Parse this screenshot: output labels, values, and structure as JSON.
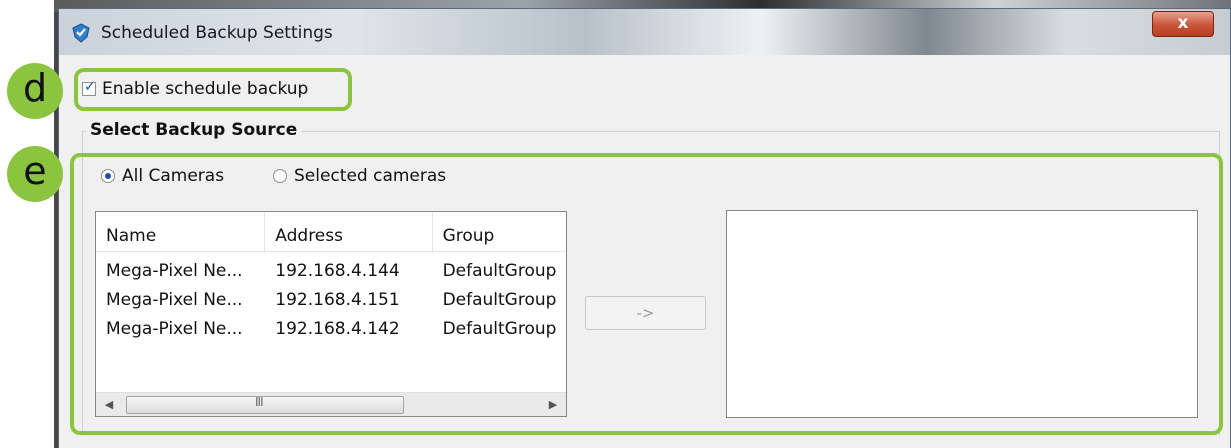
{
  "window": {
    "title": "Scheduled Backup Settings",
    "close_label": "x"
  },
  "enable_backup": {
    "label": "Enable schedule backup",
    "checked": true
  },
  "source_group": {
    "title": "Select Backup Source"
  },
  "source_options": [
    {
      "label": "All Cameras",
      "selected": true
    },
    {
      "label": "Selected cameras",
      "selected": false
    }
  ],
  "camera_list": {
    "columns": [
      "Name",
      "Address",
      "Group"
    ],
    "rows": [
      [
        "Mega-Pixel Ne...",
        "192.168.4.144",
        "DefaultGroup"
      ],
      [
        "Mega-Pixel Ne...",
        "192.168.4.151",
        "DefaultGroup"
      ],
      [
        "Mega-Pixel Ne...",
        "192.168.4.142",
        "DefaultGroup"
      ]
    ],
    "scroll_left": "◀",
    "scroll_right": "▶",
    "scroll_grip": "III"
  },
  "move_button": {
    "label": "->"
  },
  "annotations": {
    "d": "d",
    "e": "e",
    "color": "#8bc53f"
  },
  "icons": {
    "app": "shield-check-icon"
  }
}
